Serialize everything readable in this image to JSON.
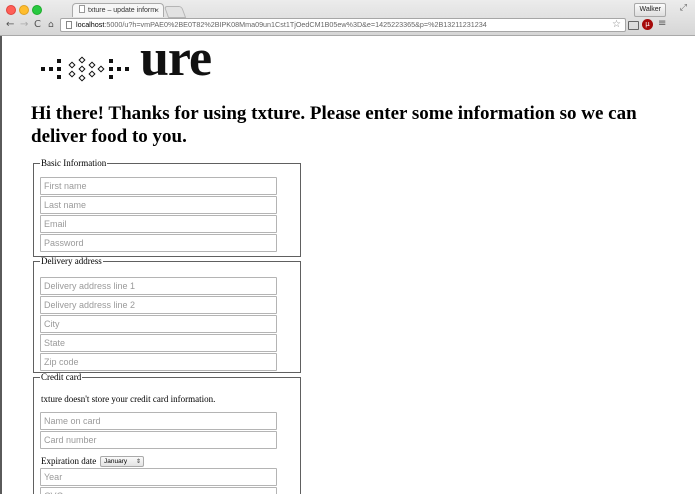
{
  "browser": {
    "tab_title": "txture – update information",
    "tab_close": "×",
    "user_button": "Walker",
    "url_host": "localhost",
    "url_rest": ":5000/u?h=vmPAE0%2BE0T82%2BIPK08Mma09un1Cst1TjOedCM1B05ew%3D&e=1425223365&p=%2B13211231234",
    "extension_badge": "μ",
    "icons": {
      "back": "←",
      "forward": "→",
      "reload": "C",
      "home": "⌂",
      "star": "☆",
      "menu": "≡",
      "fullscreen": "⤢"
    }
  },
  "page": {
    "logo_text": "ure",
    "heading": "Hi there! Thanks for using txture. Please enter some information so we can deliver food to you.",
    "basic_info": {
      "legend": "Basic Information",
      "first_name": "First name",
      "last_name": "Last name",
      "email": "Email",
      "password": "Password"
    },
    "delivery": {
      "legend": "Delivery address",
      "line1": "Delivery address line 1",
      "line2": "Delivery address line 2",
      "city": "City",
      "state": "State",
      "zip": "Zip code"
    },
    "credit_card": {
      "legend": "Credit card",
      "note": "txture doesn't store your credit card information.",
      "name_on_card": "Name on card",
      "card_number": "Card number",
      "expiration_label": "Expiration date",
      "expiration_month": "January",
      "year": "Year",
      "cvc": "CVC"
    }
  }
}
